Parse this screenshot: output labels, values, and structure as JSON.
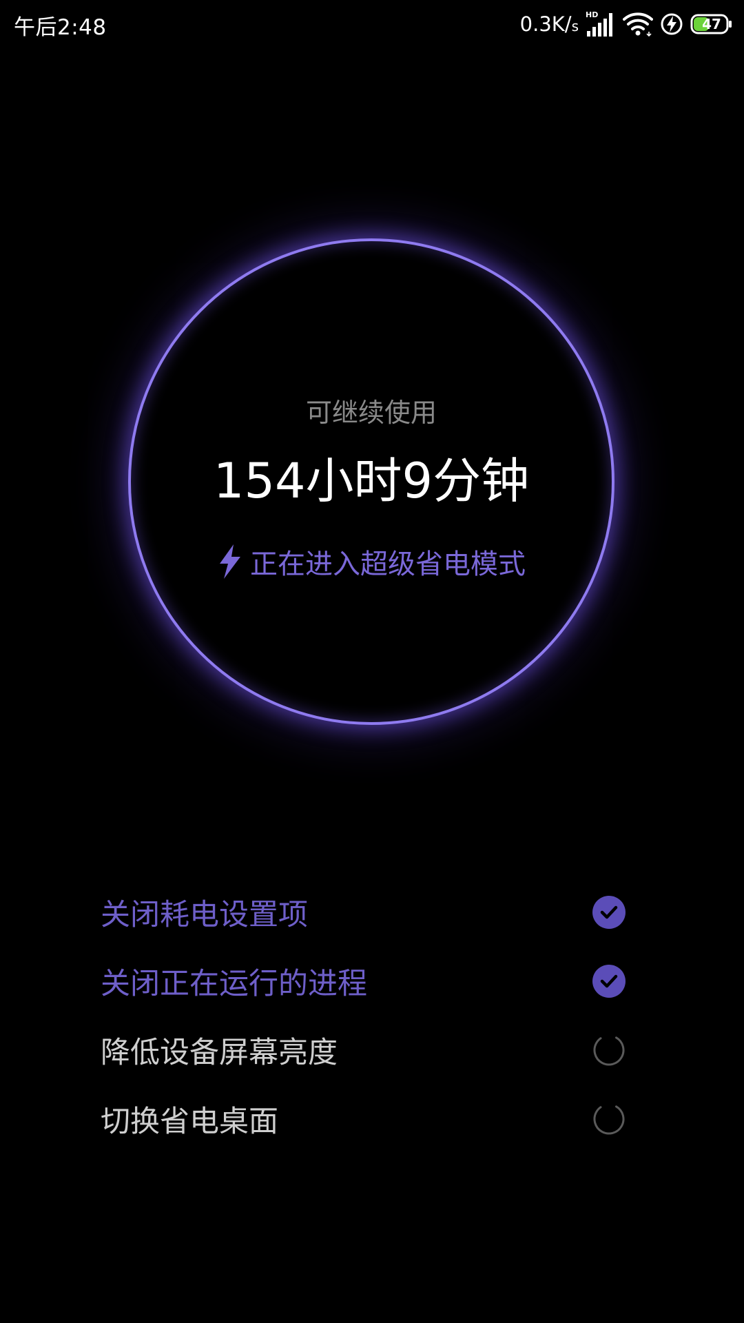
{
  "status_bar": {
    "time": "午后2:48",
    "net_speed_value": "0.3K/",
    "net_speed_unit": "s",
    "signal_badge": "HD",
    "battery_level": "47",
    "icons": [
      "signal-icon",
      "wifi-icon",
      "charging-icon",
      "battery-icon"
    ]
  },
  "ring": {
    "caption": "可继续使用",
    "remaining_time": "154小时9分钟",
    "status_text": "正在进入超级省电模式",
    "status_icon": "lightning-icon"
  },
  "tasks": [
    {
      "label": "关闭耗电设置项",
      "state": "done"
    },
    {
      "label": "关闭正在运行的进程",
      "state": "done"
    },
    {
      "label": "降低设备屏幕亮度",
      "state": "pending"
    },
    {
      "label": "切换省电桌面",
      "state": "pending"
    }
  ],
  "colors": {
    "accent": "#7a68d8",
    "ring": "#8f7bf0",
    "background": "#000000",
    "pending_text": "#cfcfcf",
    "caption_text": "#8a8a8a",
    "battery_fill": "#6cd33a"
  }
}
